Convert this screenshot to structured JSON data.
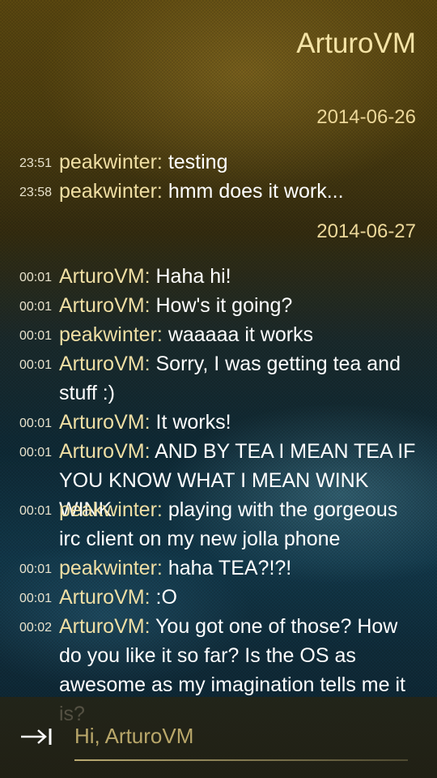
{
  "header": {
    "title": "ArturoVM"
  },
  "days": [
    {
      "date": "2014-06-26",
      "messages": [
        {
          "time": "23:51",
          "nick": "peakwinter",
          "text": "testing"
        },
        {
          "time": "23:58",
          "nick": "peakwinter",
          "text": "hmm does it work..."
        }
      ]
    },
    {
      "date": "2014-06-27",
      "messages": [
        {
          "time": "00:01",
          "nick": "ArturoVM",
          "text": "Haha hi!"
        },
        {
          "time": "00:01",
          "nick": "ArturoVM",
          "text": "How's it going?"
        },
        {
          "time": "00:01",
          "nick": "peakwinter",
          "text": "waaaaa it works"
        },
        {
          "time": "00:01",
          "nick": "ArturoVM",
          "text": "Sorry, I was getting tea and stuff :)"
        },
        {
          "time": "00:01",
          "nick": "ArturoVM",
          "text": "It works!"
        },
        {
          "time": "00:01",
          "nick": "ArturoVM",
          "text": "AND BY TEA I MEAN TEA IF YOU KNOW WHAT I MEAN WINK WINK"
        },
        {
          "time": "00:01",
          "nick": "peakwinter",
          "text": "playing with the gorgeous irc client on my new jolla phone"
        },
        {
          "time": "00:01",
          "nick": "peakwinter",
          "text": "haha TEA?!?!"
        },
        {
          "time": "00:01",
          "nick": "ArturoVM",
          "text": ":O"
        },
        {
          "time": "00:02",
          "nick": "ArturoVM",
          "text": "You got one of those? How do you like it so far? Is the OS as awesome as my imagination tells me it is?"
        }
      ]
    }
  ],
  "composer": {
    "placeholder": "Hi, ArturoVM",
    "send_icon": "send-arrow-icon"
  },
  "colors": {
    "nick": "#f0dfa4",
    "text": "#ffffff",
    "accent": "#f4e3a6"
  }
}
